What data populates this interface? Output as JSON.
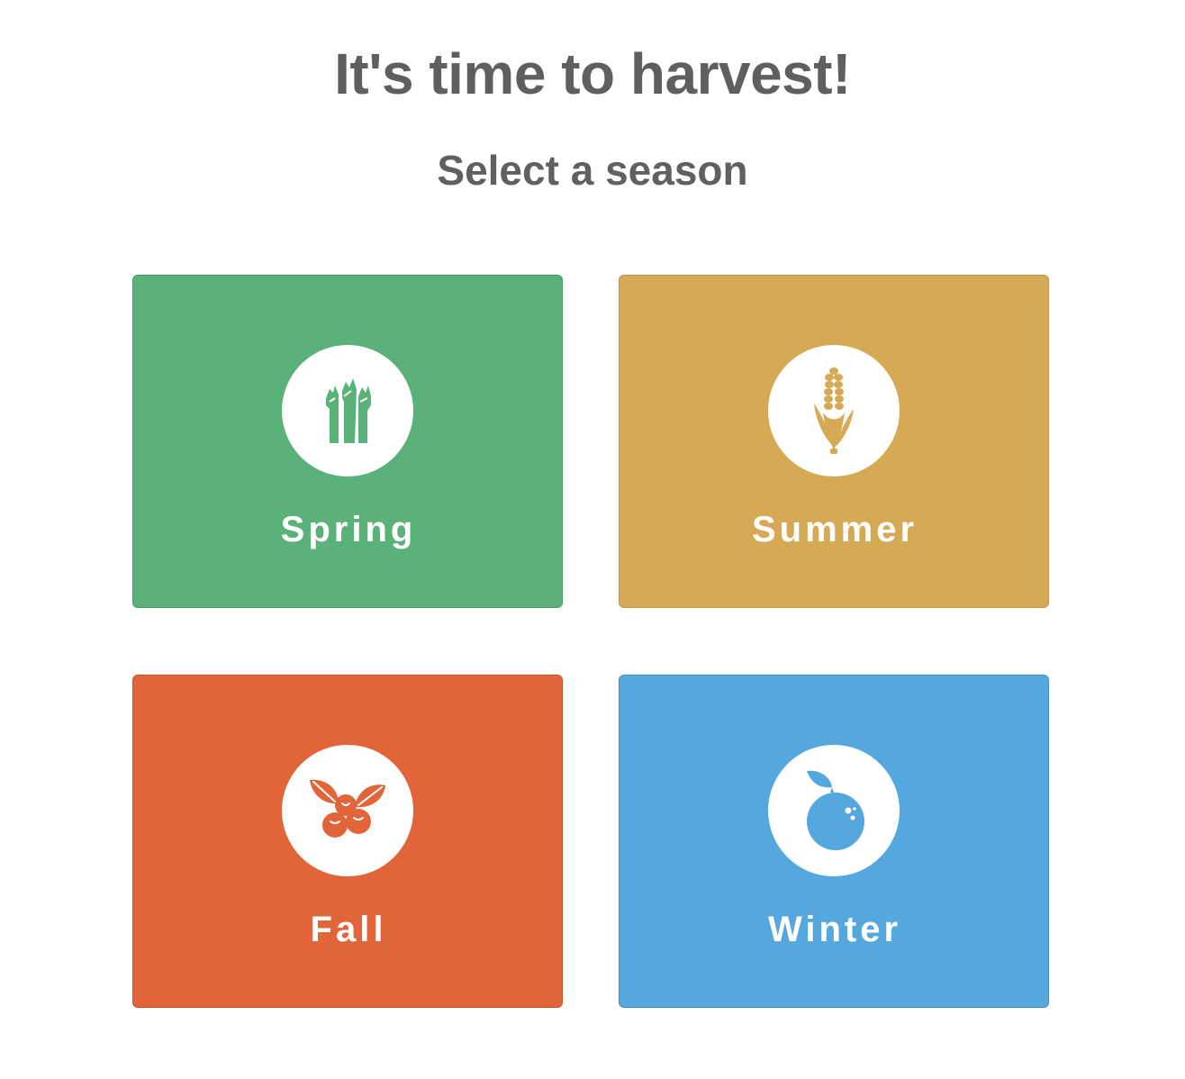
{
  "header": {
    "title": "It's time to harvest!",
    "subtitle": "Select a season"
  },
  "seasons": [
    {
      "label": "Spring",
      "icon": "asparagus-icon",
      "color": "#5ab27a",
      "border": "#4a9a67"
    },
    {
      "label": "Summer",
      "icon": "corn-icon",
      "color": "#d6aa55",
      "border": "#bf9545"
    },
    {
      "label": "Fall",
      "icon": "berries-icon",
      "color": "#e16539",
      "border": "#c9542c"
    },
    {
      "label": "Winter",
      "icon": "orange-icon",
      "color": "#54a8dd",
      "border": "#4390c4"
    }
  ]
}
